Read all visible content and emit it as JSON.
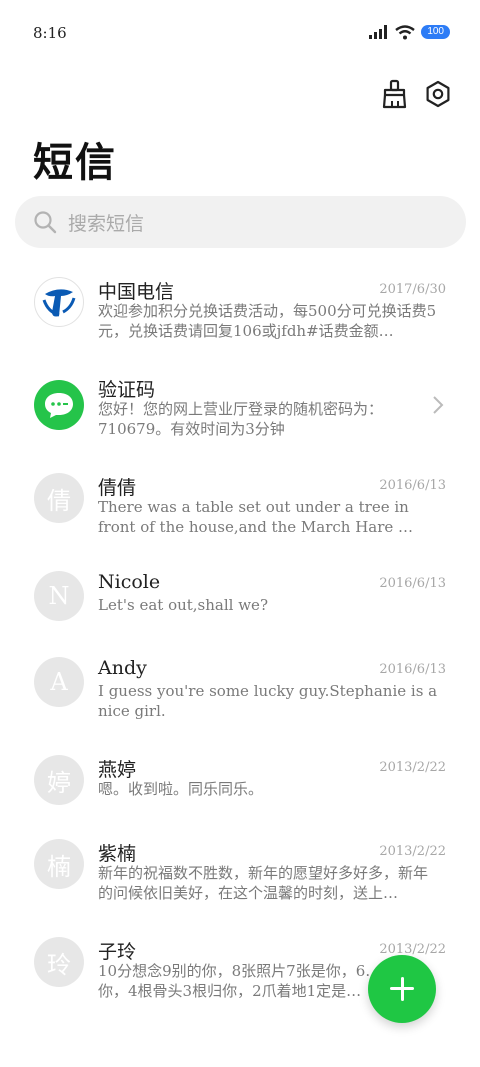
{
  "status_bar": {
    "time": "8:16",
    "battery": "100"
  },
  "header": {
    "title": "短信",
    "clean_icon": "broom-icon",
    "settings_icon": "gear-icon"
  },
  "search": {
    "placeholder": "搜索短信",
    "icon": "search-icon"
  },
  "conversations": [
    {
      "name": "中国电信",
      "date": "2017/6/30",
      "preview": "欢迎参加积分兑换话费活动，每500分可兑换话费5元，兑换话费请回复106或jfdh#话费金额…",
      "avatar": "china-telecom-logo"
    },
    {
      "name": "验证码",
      "date": "",
      "preview": "您好！您的网上营业厅登录的随机密码为：710679。有效时间为3分钟",
      "avatar": "message-icon"
    },
    {
      "name": "倩倩",
      "date": "2016/6/13",
      "preview": "There was a table set out under a tree in front of the house,and the March Hare …",
      "avatar_letter": "倩"
    },
    {
      "name": "Nicole",
      "date": "2016/6/13",
      "preview": "Let's eat out,shall we?",
      "avatar_letter": "N"
    },
    {
      "name": "Andy",
      "date": "2016/6/13",
      "preview": "I guess you're some lucky guy.Stephanie is a nice girl.",
      "avatar_letter": "A"
    },
    {
      "name": "燕婷",
      "date": "2013/2/22",
      "preview": "嗯。收到啦。同乐同乐。",
      "avatar_letter": "婷"
    },
    {
      "name": "紫楠",
      "date": "2013/2/22",
      "preview": "新年的祝福数不胜数，新年的愿望好多好多，新年的问候依旧美好，在这个温馨的时刻，送上…",
      "avatar_letter": "楠"
    },
    {
      "name": "子玲",
      "date": "2013/2/22",
      "preview": "10分想念9别的你，8张照片7张是你，6…只像你，4根骨头3根归你，2爪着地1定是…",
      "avatar_letter": "玲"
    }
  ],
  "fab": {
    "icon": "plus-icon"
  },
  "colors": {
    "accent_green": "#1fc744",
    "battery_blue": "#2d7cf6"
  }
}
